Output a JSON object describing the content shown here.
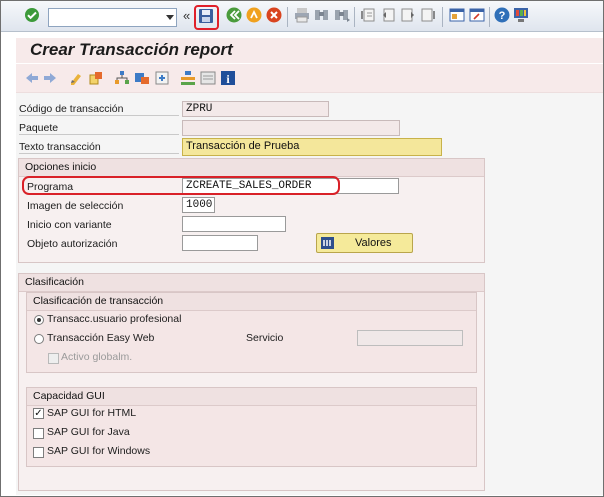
{
  "toolbar": {
    "icons": [
      "enter-check-icon",
      "save-icon",
      "back-icon",
      "exit-icon",
      "cancel-icon",
      "print-icon",
      "find-icon",
      "find-next-icon",
      "first-page-icon",
      "previous-page-icon",
      "next-page-icon",
      "last-page-icon",
      "create-session-icon",
      "shortcut-icon",
      "help-icon",
      "customize-layout-icon"
    ],
    "command_field": "",
    "chevron": "«"
  },
  "title": "Crear Transacción report",
  "fields": {
    "codigo_label": "Código de transacción",
    "codigo_value": "ZPRU",
    "paquete_label": "Paquete",
    "paquete_value": "",
    "texto_label": "Texto transacción",
    "texto_value": "Transacción de Prueba"
  },
  "opciones": {
    "title": "Opciones inicio",
    "programa_label": "Programa",
    "programa_value": "ZCREATE_SALES_ORDER",
    "imagen_label": "Imagen de selección",
    "imagen_value": "1000",
    "variante_label": "Inicio con variante",
    "variante_value": "",
    "objeto_label": "Objeto autorización",
    "objeto_value": "",
    "valores_button": "Valores"
  },
  "clasificacion": {
    "title": "Clasificación",
    "trans_title": "Clasificación de transacción",
    "radio1": "Transacc.usuario profesional",
    "radio2": "Transacción Easy Web",
    "servicio_label": "Servicio",
    "activo_label": "Activo globalm.",
    "gui_title": "Capacidad GUI",
    "gui_html": "SAP GUI for HTML",
    "gui_java": "SAP GUI for Java",
    "gui_windows": "SAP GUI for Windows"
  },
  "state": {
    "radio_selected": "Transacc.usuario profesional",
    "gui_html_checked": true,
    "gui_java_checked": false,
    "gui_windows_checked": false
  },
  "colors": {
    "highlight_red": "#e0202a",
    "title_band": "#f7eaea",
    "field_highlight": "#f4e79b"
  }
}
